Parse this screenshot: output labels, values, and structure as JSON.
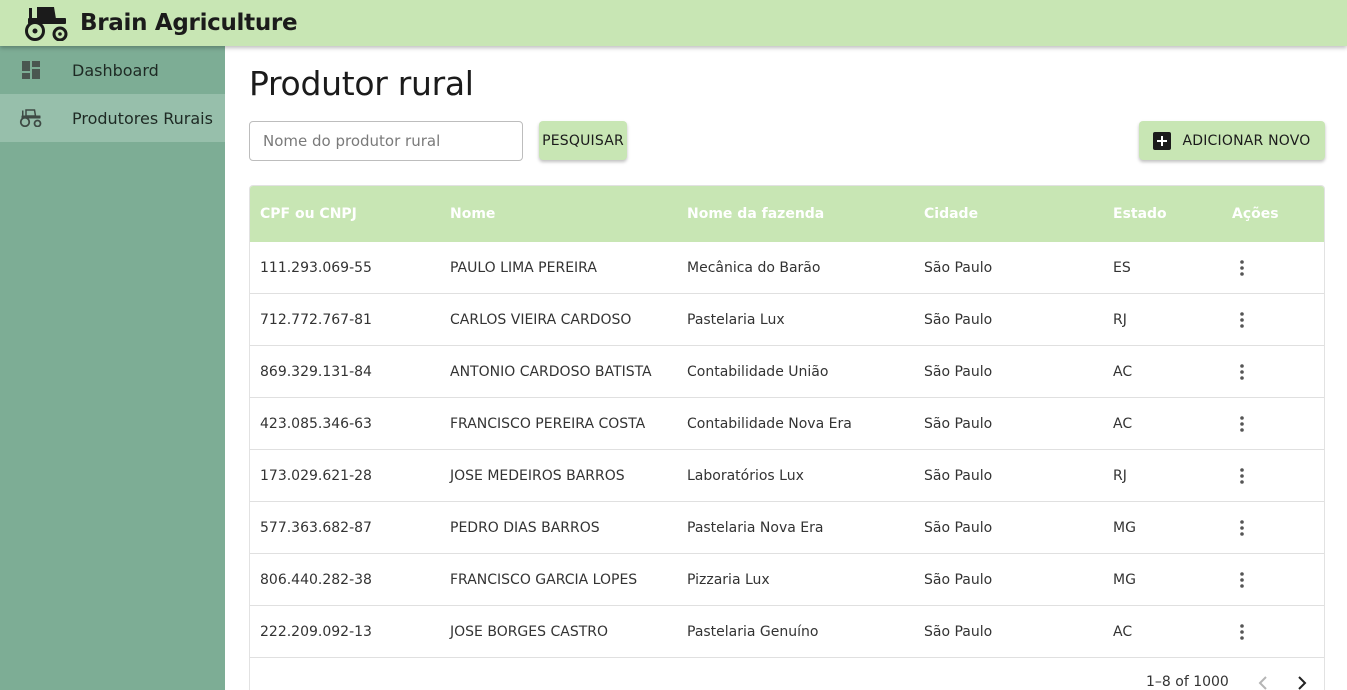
{
  "app": {
    "title": "Brain Agriculture",
    "logo_icon": "tractor-icon",
    "colors": {
      "header_bg": "#c8e6b4",
      "sidebar_bg": "#7dad95",
      "sidebar_active_bg": "#97bfab",
      "accent": "#c8e6b4"
    }
  },
  "sidebar": {
    "items": [
      {
        "label": "Dashboard",
        "icon": "dashboard-icon",
        "active": false
      },
      {
        "label": "Produtores Rurais",
        "icon": "tractor-icon",
        "active": true
      }
    ]
  },
  "main": {
    "title": "Produtor rural",
    "search": {
      "placeholder": "Nome do produtor rural",
      "value": ""
    },
    "search_button": "PESQUISAR",
    "add_button": "ADICIONAR NOVO"
  },
  "table": {
    "columns": [
      "CPF ou CNPJ",
      "Nome",
      "Nome da fazenda",
      "Cidade",
      "Estado",
      "Ações"
    ],
    "rows": [
      [
        "111.293.069-55",
        "PAULO LIMA PEREIRA",
        "Mecânica do Barão",
        "São Paulo",
        "ES"
      ],
      [
        "712.772.767-81",
        "CARLOS VIEIRA CARDOSO",
        "Pastelaria Lux",
        "São Paulo",
        "RJ"
      ],
      [
        "869.329.131-84",
        "ANTONIO CARDOSO BATISTA",
        "Contabilidade União",
        "São Paulo",
        "AC"
      ],
      [
        "423.085.346-63",
        "FRANCISCO PEREIRA COSTA",
        "Contabilidade Nova Era",
        "São Paulo",
        "AC"
      ],
      [
        "173.029.621-28",
        "JOSE MEDEIROS BARROS",
        "Laboratórios Lux",
        "São Paulo",
        "RJ"
      ],
      [
        "577.363.682-87",
        "PEDRO DIAS BARROS",
        "Pastelaria Nova Era",
        "São Paulo",
        "MG"
      ],
      [
        "806.440.282-38",
        "FRANCISCO GARCIA LOPES",
        "Pizzaria Lux",
        "São Paulo",
        "MG"
      ],
      [
        "222.209.092-13",
        "JOSE BORGES CASTRO",
        "Pastelaria Genuíno",
        "São Paulo",
        "AC"
      ]
    ],
    "pagination": {
      "range": "1–8 of 1000"
    }
  }
}
